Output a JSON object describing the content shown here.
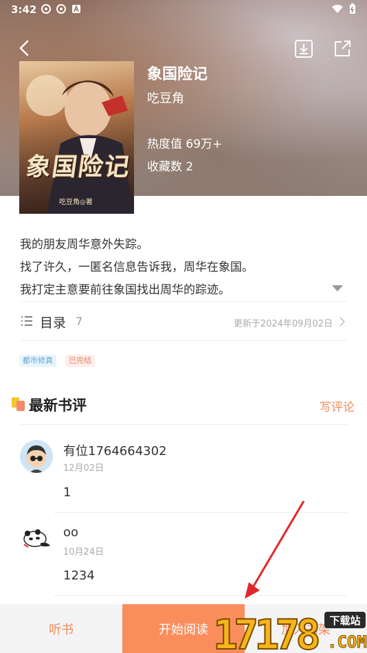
{
  "status_bar": {
    "time": "3:42"
  },
  "book": {
    "title": "象国险记",
    "author": "吃豆角",
    "heat": "热度值 69万+",
    "favorites": "收藏数 2",
    "cover_title": "象国险记",
    "cover_author": "吃豆角◎著"
  },
  "intro": {
    "line1": "我的朋友周华意外失踪。",
    "line2": "找了许久，一匿名信息告诉我，周华在象国。",
    "line3": "我打定主意要前往象国找出周华的踪迹。"
  },
  "toc": {
    "label": "目录",
    "count": "7",
    "updated": "更新于2024年09月02日"
  },
  "tags": [
    "都市修真",
    "已完结"
  ],
  "reviews": {
    "title": "最新书评",
    "write_label": "写评论",
    "items": [
      {
        "name": "有位1764664302",
        "date": "12月02日",
        "body": "1"
      },
      {
        "name": "oo",
        "date": "10月24日",
        "body": "1234"
      }
    ]
  },
  "bottom": {
    "listen": "听书",
    "read": "开始阅读",
    "shelf": "加入书架"
  },
  "watermark": {
    "text": "17178",
    "badge": "下载站",
    "domain": ".COM"
  },
  "colors": {
    "accent": "#f98e5c",
    "accent_text": "#f08a5a",
    "arrow": "#e3262b"
  }
}
